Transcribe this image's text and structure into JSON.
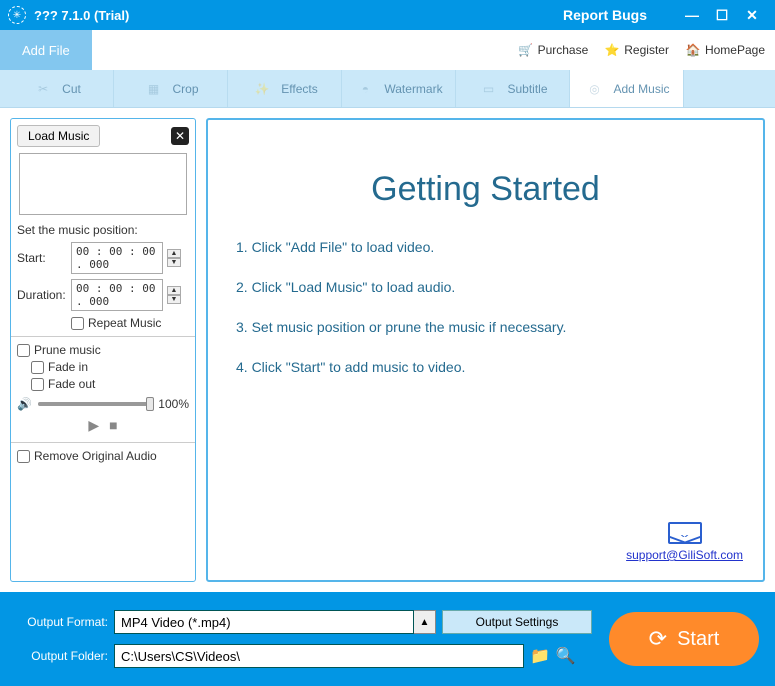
{
  "titlebar": {
    "app_icon": "snowflake-icon",
    "title": "??? 7.1.0 (Trial)",
    "report_bugs": "Report Bugs"
  },
  "toolbar": {
    "add_file": "Add File",
    "purchase": "Purchase",
    "register": "Register",
    "homepage": "HomePage"
  },
  "tabs": {
    "cut": "Cut",
    "crop": "Crop",
    "effects": "Effects",
    "watermark": "Watermark",
    "subtitle": "Subtitle",
    "add_music": "Add Music"
  },
  "side": {
    "load_music": "Load Music",
    "set_position": "Set the music position:",
    "start_label": "Start:",
    "start_value": "00 : 00 : 00 . 000",
    "duration_label": "Duration:",
    "duration_value": "00 : 00 : 00 . 000",
    "repeat": "Repeat Music",
    "prune": "Prune music",
    "fade_in": "Fade in",
    "fade_out": "Fade out",
    "volume_pct": "100%",
    "remove_original": "Remove Original Audio"
  },
  "main": {
    "title": "Getting Started",
    "steps": [
      "1. Click \"Add File\" to load video.",
      "2. Click \"Load Music\" to load audio.",
      "3. Set music position or prune the music if necessary.",
      "4. Click \"Start\" to add music to video."
    ],
    "support_email": "support@GiliSoft.com"
  },
  "bottom": {
    "format_label": "Output Format:",
    "format_value": "MP4 Video (*.mp4)",
    "output_settings": "Output Settings",
    "folder_label": "Output Folder:",
    "folder_value": "C:\\Users\\CS\\Videos\\",
    "start": "Start"
  }
}
